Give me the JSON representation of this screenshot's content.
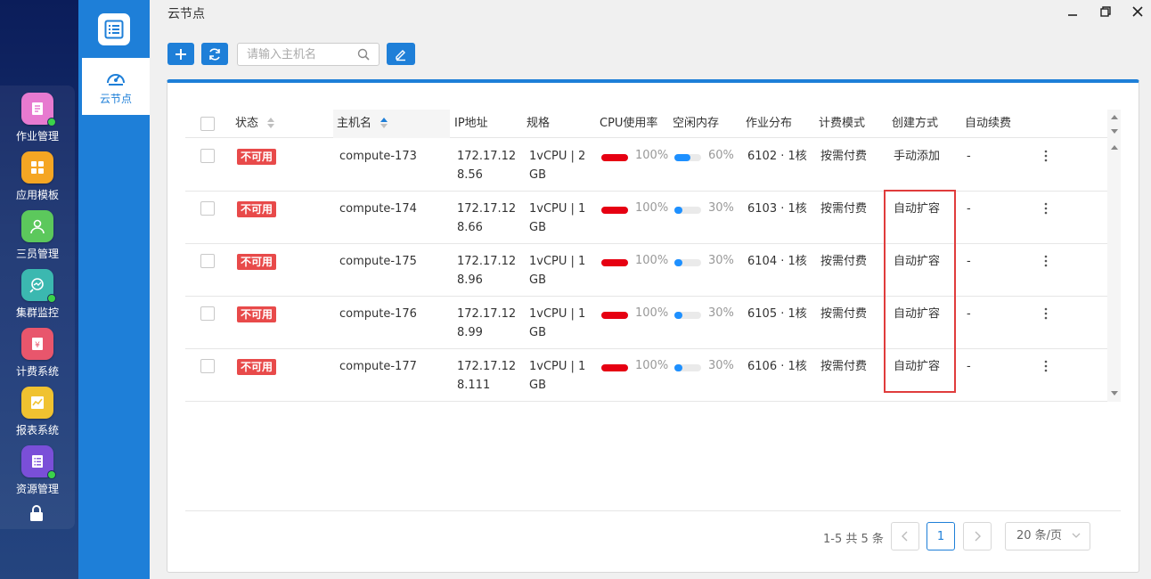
{
  "dock": {
    "items": [
      {
        "label": "作业管理",
        "icon": "job-icon",
        "color": "#e77ad0",
        "dot": true
      },
      {
        "label": "应用模板",
        "icon": "grid-icon",
        "color": "#f5a623",
        "dot": false
      },
      {
        "label": "三员管理",
        "icon": "user-icon",
        "color": "#5cc85c",
        "dot": false
      },
      {
        "label": "集群监控",
        "icon": "monitor-icon",
        "color": "#3bb8b0",
        "dot": true
      },
      {
        "label": "计费系统",
        "icon": "billing-icon",
        "color": "#e8566c",
        "dot": false
      },
      {
        "label": "报表系统",
        "icon": "chart-icon",
        "color": "#f0c230",
        "dot": false
      },
      {
        "label": "资源管理",
        "icon": "list-icon",
        "color": "#7a4fd8",
        "dot": true
      }
    ]
  },
  "nav": {
    "item_label": "云节点"
  },
  "window": {
    "title": "云节点"
  },
  "toolbar": {
    "search_placeholder": "请输入主机名"
  },
  "table": {
    "headers": {
      "status": "状态",
      "hostname": "主机名",
      "ip": "IP地址",
      "spec": "规格",
      "cpu": "CPU使用率",
      "mem": "空闲内存",
      "job": "作业分布",
      "billing": "计费模式",
      "create": "创建方式",
      "renew": "自动续费"
    },
    "rows": [
      {
        "status": "不可用",
        "hostname": "compute-173",
        "ip1": "172.17.12",
        "ip2": "8.56",
        "spec1": "1vCPU | 2",
        "spec2": "GB",
        "cpu_pct": "100%",
        "cpu_val": 100,
        "mem_pct": "60%",
        "mem_val": 60,
        "job": "6102 · 1核",
        "billing": "按需付费",
        "create": "手动添加",
        "renew": "-"
      },
      {
        "status": "不可用",
        "hostname": "compute-174",
        "ip1": "172.17.12",
        "ip2": "8.66",
        "spec1": "1vCPU | 1",
        "spec2": "GB",
        "cpu_pct": "100%",
        "cpu_val": 100,
        "mem_pct": "30%",
        "mem_val": 30,
        "job": "6103 · 1核",
        "billing": "按需付费",
        "create": "自动扩容",
        "renew": "-"
      },
      {
        "status": "不可用",
        "hostname": "compute-175",
        "ip1": "172.17.12",
        "ip2": "8.96",
        "spec1": "1vCPU | 1",
        "spec2": "GB",
        "cpu_pct": "100%",
        "cpu_val": 100,
        "mem_pct": "30%",
        "mem_val": 30,
        "job": "6104 · 1核",
        "billing": "按需付费",
        "create": "自动扩容",
        "renew": "-"
      },
      {
        "status": "不可用",
        "hostname": "compute-176",
        "ip1": "172.17.12",
        "ip2": "8.99",
        "spec1": "1vCPU | 1",
        "spec2": "GB",
        "cpu_pct": "100%",
        "cpu_val": 100,
        "mem_pct": "30%",
        "mem_val": 30,
        "job": "6105 · 1核",
        "billing": "按需付费",
        "create": "自动扩容",
        "renew": "-"
      },
      {
        "status": "不可用",
        "hostname": "compute-177",
        "ip1": "172.17.12",
        "ip2": "8.111",
        "spec1": "1vCPU | 1",
        "spec2": "GB",
        "cpu_pct": "100%",
        "cpu_val": 100,
        "mem_pct": "30%",
        "mem_val": 30,
        "job": "6106 · 1核",
        "billing": "按需付费",
        "create": "自动扩容",
        "renew": "-"
      }
    ]
  },
  "pagination": {
    "summary": "1-5 共 5 条",
    "current_page": "1",
    "page_size": "20 条/页"
  },
  "colors": {
    "primary": "#1e7fd8",
    "danger": "#e84a4a",
    "cpu_bar": "#e60012",
    "mem_bar": "#1e90ff"
  }
}
